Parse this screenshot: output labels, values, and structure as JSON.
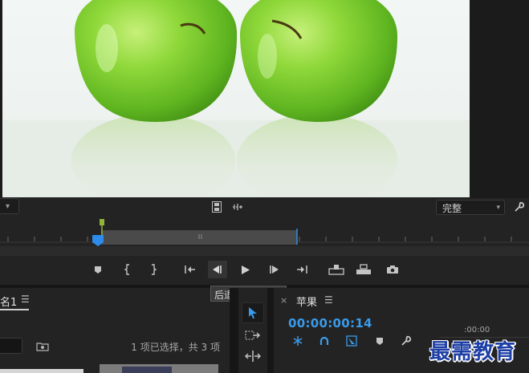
{
  "monitor": {
    "quality_value": "完整",
    "tooltip": "后退一帧 (左侧)"
  },
  "colors": {
    "accent_blue": "#3a9bea",
    "playhead_blue": "#2d8ceb",
    "in_marker_green": "#8fb43a",
    "watermark_blue": "#1e3fa6"
  },
  "icons": {
    "source_chevron": "chevron-down-icon",
    "filmstrip": "filmstrip-icon",
    "audio_waveform": "audio-waveform-icon",
    "quality_arrow": "chevron-down-icon",
    "settings": "wrench-icon",
    "transport": [
      "add-marker-icon",
      "mark-in-icon",
      "mark-out-icon",
      "go-to-in-icon",
      "step-back-icon",
      "play-icon",
      "step-forward-icon",
      "go-to-out-icon",
      "lift-icon",
      "extract-icon",
      "camera-icon"
    ],
    "tools": [
      "selection-tool-icon",
      "track-select-tool-icon",
      "ripple-edit-tool-icon"
    ],
    "timeline_tools": [
      "snap-icon",
      "linked-selection-icon",
      "add-marker-icon",
      "add-marker-icon",
      "wrench-icon"
    ]
  },
  "project_panel": {
    "tab_label": "名1",
    "menu_glyph": "☰",
    "status": "1 项已选择，共 3 项"
  },
  "timeline_panel": {
    "close_glyph": "×",
    "sequence_name": "苹果",
    "menu_glyph": "☰",
    "timecode": "00:00:00:14",
    "ruler_label": ":00:00"
  },
  "watermark": "最需教育"
}
